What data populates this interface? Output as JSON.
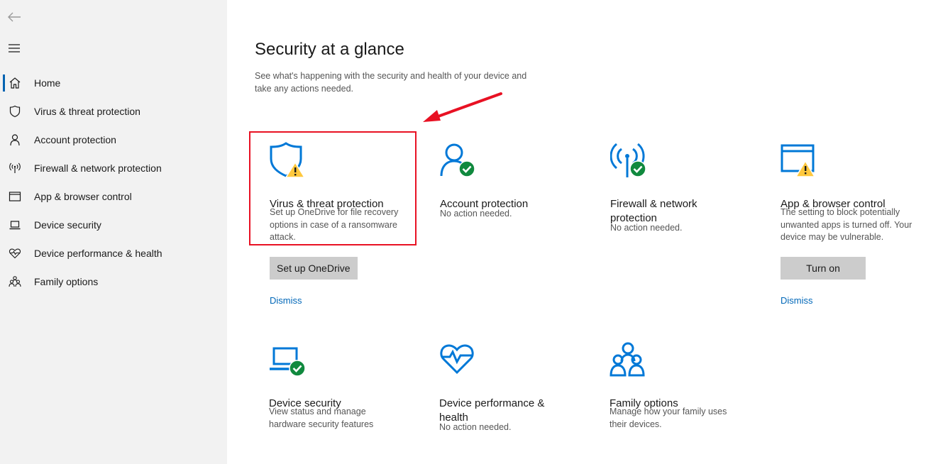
{
  "sidebar": {
    "items": [
      {
        "label": "Home",
        "icon": "home-icon",
        "active": true
      },
      {
        "label": "Virus & threat protection",
        "icon": "shield-icon"
      },
      {
        "label": "Account protection",
        "icon": "person-icon"
      },
      {
        "label": "Firewall & network protection",
        "icon": "antenna-icon"
      },
      {
        "label": "App & browser control",
        "icon": "browser-window-icon"
      },
      {
        "label": "Device security",
        "icon": "laptop-icon"
      },
      {
        "label": "Device performance & health",
        "icon": "heart-pulse-icon"
      },
      {
        "label": "Family options",
        "icon": "family-icon"
      }
    ]
  },
  "main": {
    "title": "Security at a glance",
    "description": "See what's happening with the security and health of your device and take any actions needed."
  },
  "tiles": {
    "virus": {
      "title": "Virus & threat protection",
      "description": "Set up OneDrive for file recovery options in case of a ransomware attack.",
      "button": "Set up OneDrive",
      "link": "Dismiss",
      "status": "warning"
    },
    "account": {
      "title": "Account protection",
      "description": "No action needed.",
      "status": "ok"
    },
    "firewall": {
      "title": "Firewall & network protection",
      "description": "No action needed.",
      "status": "ok"
    },
    "app": {
      "title": "App & browser control",
      "description": "The setting to block potentially unwanted apps is turned off. Your device may be vulnerable.",
      "button": "Turn on",
      "link": "Dismiss",
      "status": "warning"
    },
    "device": {
      "title": "Device security",
      "description": "View status and manage hardware security features",
      "status": "ok"
    },
    "performance": {
      "title": "Device performance & health",
      "description": "No action needed.",
      "status": "ok"
    },
    "family": {
      "title": "Family options",
      "description": "Manage how your family uses their devices."
    }
  },
  "colors": {
    "accent": "#0078d7",
    "warning": "#ffc83d",
    "ok": "#10893e",
    "highlight": "#e81123"
  }
}
